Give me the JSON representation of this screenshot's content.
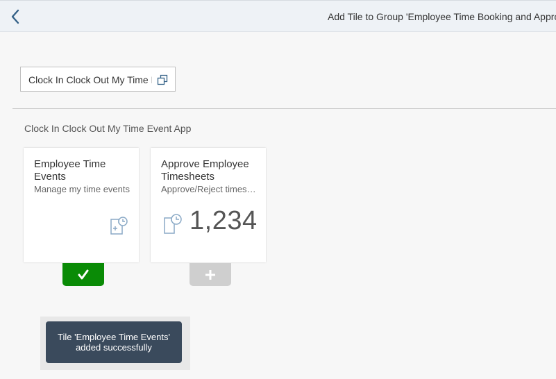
{
  "header": {
    "title": "Add Tile to Group 'Employee Time Booking and Approval'",
    "back_icon": "chevron-left-icon"
  },
  "catalog_selector": {
    "value": "Clock In Clock Out My Time Event App",
    "icon": "catalog-popup-icon"
  },
  "catalog": {
    "title": "Clock In Clock Out My Time Event App",
    "tiles": [
      {
        "title": "Employee Time Events",
        "subtitle": "Manage my time events",
        "icon": "time-entry-request-icon",
        "status": "added",
        "action_icon": "checkmark-icon"
      },
      {
        "title": "Approve Employee Timesheets",
        "subtitle": "Approve/Reject timesheets",
        "icon": "pending-time-document-icon",
        "number": "1,234",
        "status": "not-added",
        "action_icon": "add-icon"
      }
    ]
  },
  "toast": {
    "message": "Tile 'Employee Time Events' added successfully"
  },
  "colors": {
    "accent": "#346187",
    "added": "#0a8b06",
    "add_disabled": "#cfcfcf",
    "toast_bg": "#3a4a5c",
    "icon_blue": "#8aa9c6"
  }
}
